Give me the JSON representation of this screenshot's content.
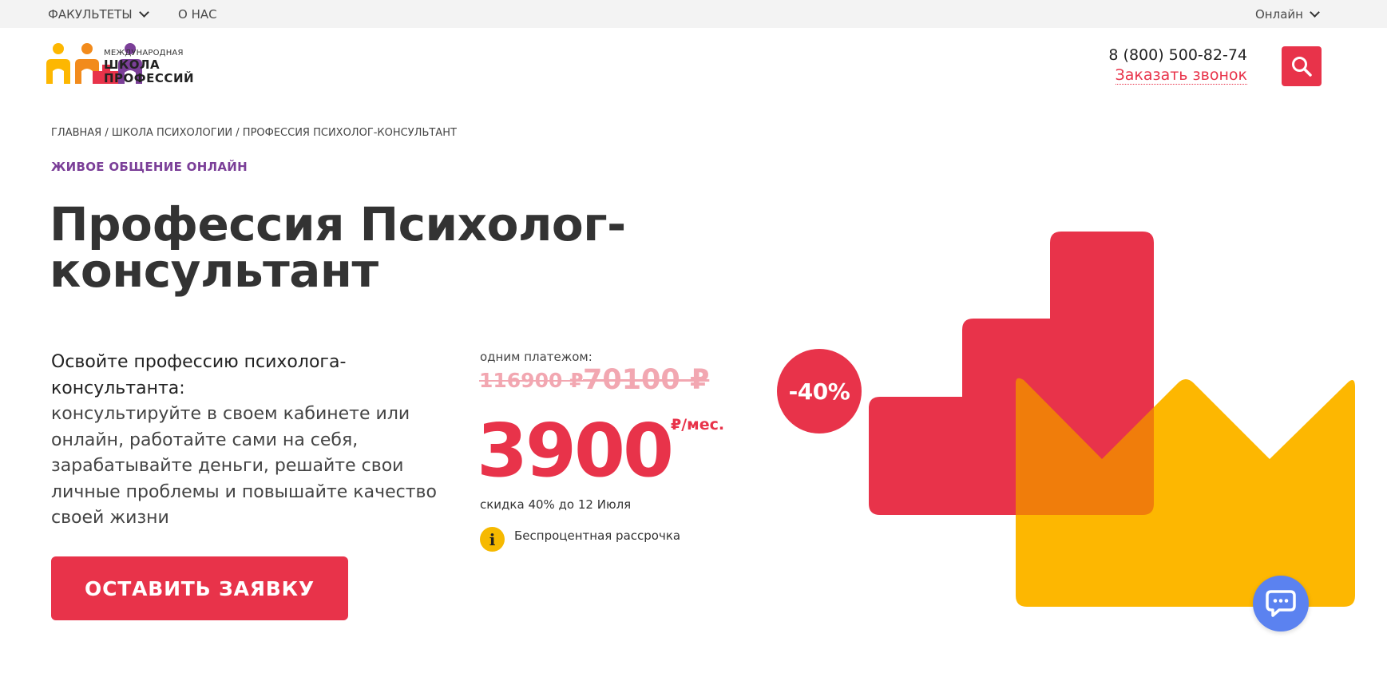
{
  "topbar": {
    "faculties": "ФАКУЛЬТЕТЫ",
    "about": "О НАС",
    "online": "Онлайн"
  },
  "logo": {
    "line1": "МЕЖДУНАРОДНАЯ",
    "line2": "ШКОЛА",
    "line3": "ПРОФЕССИЙ"
  },
  "header": {
    "phone": "8 (800) 500-82-74",
    "callback": "Заказать звонок"
  },
  "breadcrumb": [
    "ГЛАВНАЯ",
    "ШКОЛА ПСИХОЛОГИИ",
    "ПРОФЕССИЯ ПСИХОЛОГ-КОНСУЛЬТАНТ"
  ],
  "hero": {
    "tagline": "ЖИВОЕ ОБЩЕНИЕ ОНЛАЙН",
    "title_line1": "Профессия Психолог-",
    "title_line2": "консультант",
    "desc_lead": "Освойте профессию психолога-консультанта:",
    "desc_body": "консультируйте в своем кабинете или онлайн, работайте сами на себя, зарабатывайте деньги, решайте свои личные проблемы и повышайте качество своей жизни",
    "cta": "ОСТАВИТЬ ЗАЯВКУ"
  },
  "pricing": {
    "label": "одним платежом:",
    "old_price_1": "116900 ₽",
    "old_price_2": "70100 ₽",
    "monthly_price": "3900",
    "per_month": "₽/мес.",
    "discount_note": "скидка 40% до 12 Июля",
    "info_symbol": "i",
    "installment": "Беспроцентная рассрочка",
    "badge": "-40%"
  },
  "colors": {
    "accent_red": "#e8334a",
    "yellow": "#fdb701",
    "orange": "#f28b1c",
    "purple": "#7b3f98",
    "chat_blue": "#5b82f0"
  }
}
